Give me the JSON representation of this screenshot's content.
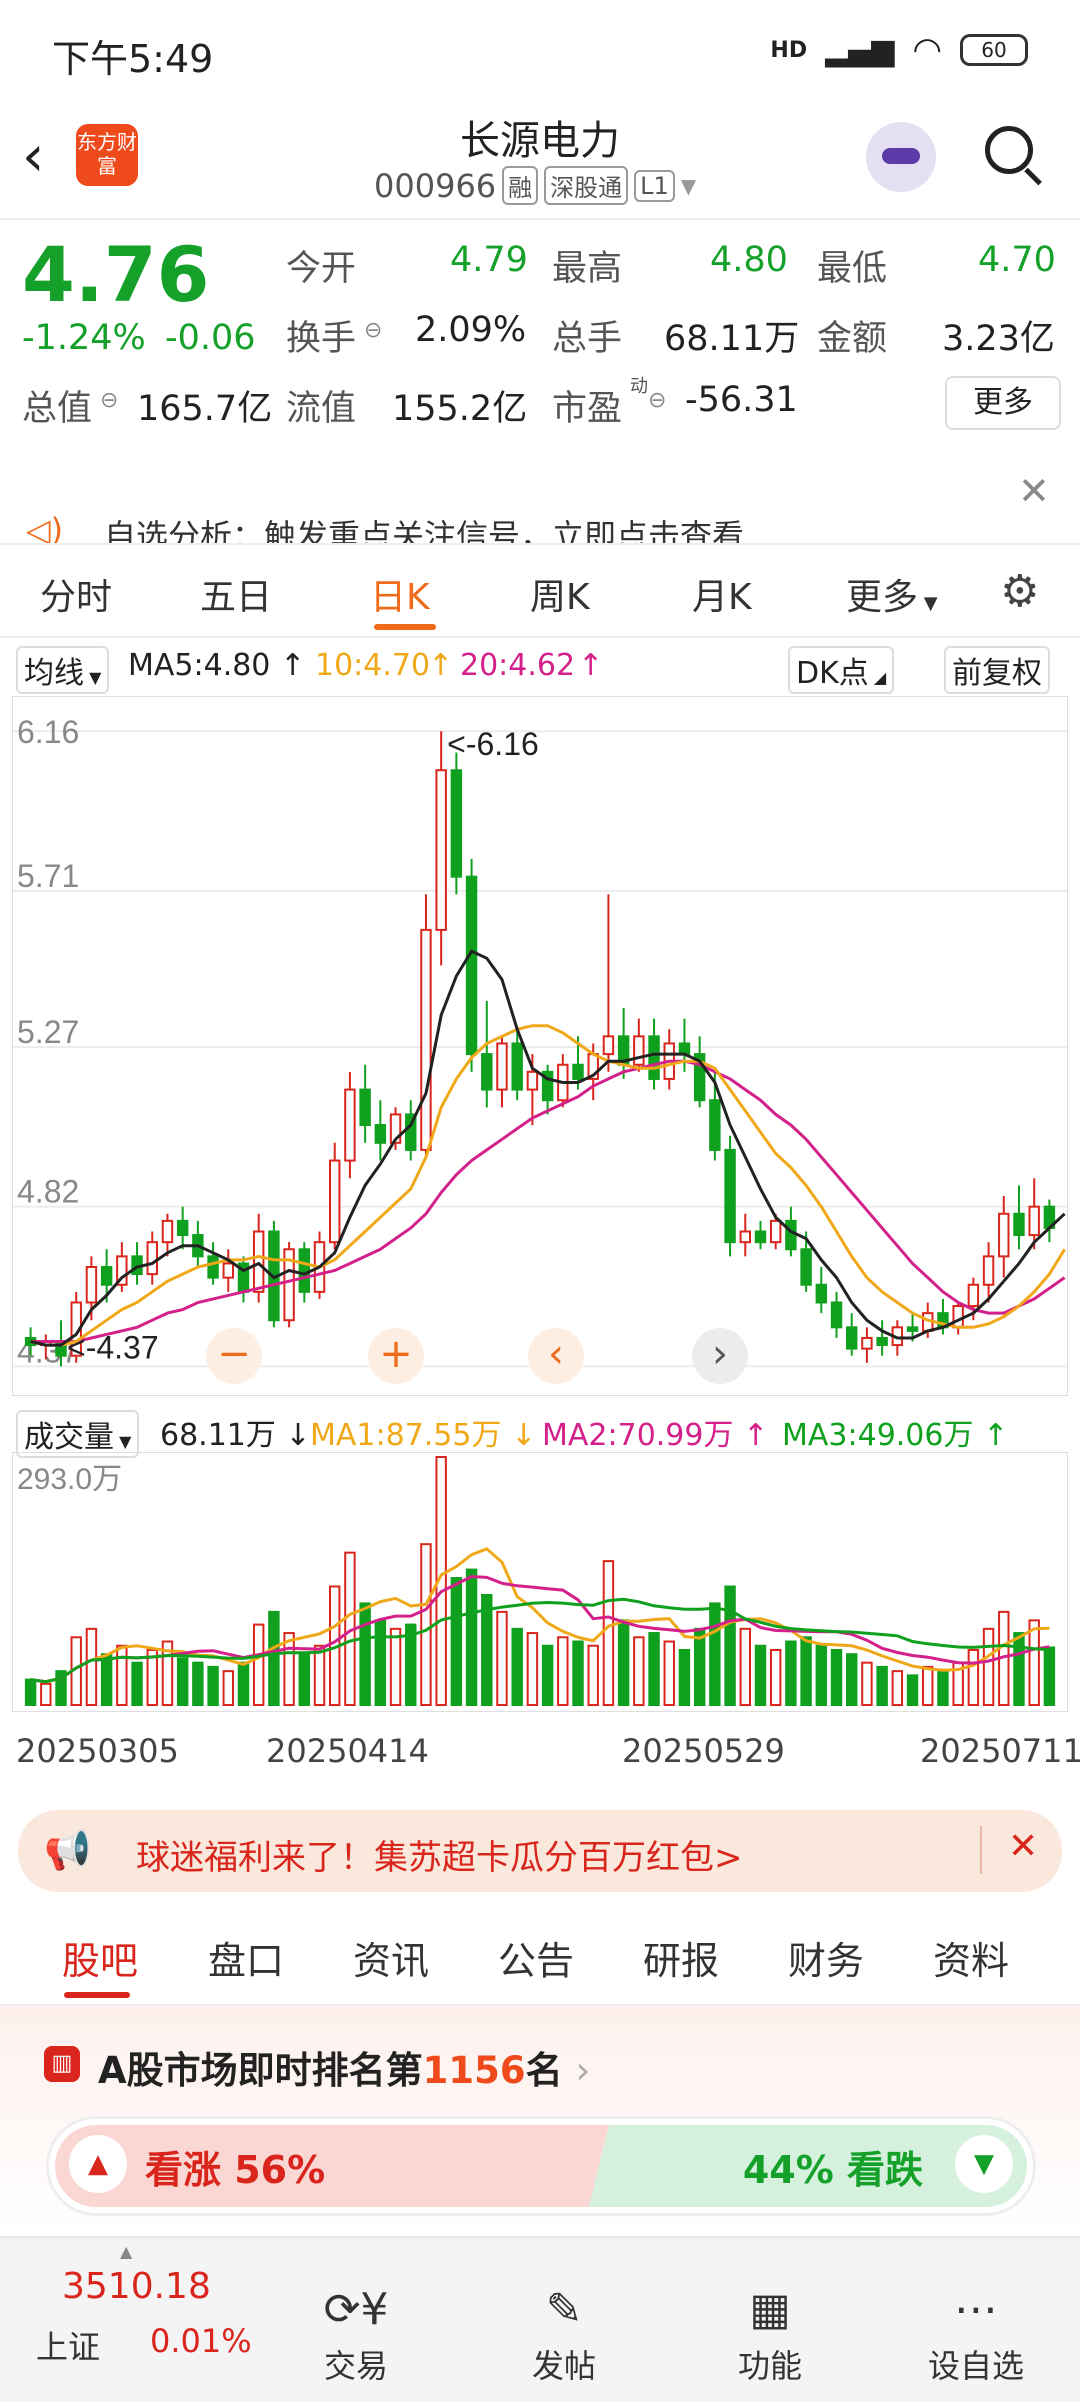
{
  "status": {
    "time": "下午5:49",
    "battery": "60",
    "signal": "HD"
  },
  "nav": {
    "title": "长源电力",
    "code": "000966",
    "tags": [
      "融",
      "深股通",
      "L1"
    ],
    "logo_text": "东方财富"
  },
  "quote": {
    "price": "4.76",
    "change_pct": "-1.24%",
    "change": "-0.06",
    "open_label": "今开",
    "open": "4.79",
    "high_label": "最高",
    "high": "4.80",
    "low_label": "最低",
    "low": "4.70",
    "turnover_label": "换手",
    "turnover": "2.09%",
    "volume_label": "总手",
    "volume": "68.11万",
    "amount_label": "金额",
    "amount": "3.23亿",
    "mktcap_label": "总值",
    "mktcap": "165.7亿",
    "float_label": "流值",
    "float": "155.2亿",
    "pe_label": "市盈",
    "pe_sup": "动",
    "pe": "-56.31",
    "more": "更多"
  },
  "notice": {
    "text": "自选分析：触发重点关注信号，立即点击查看"
  },
  "tabs": [
    "分时",
    "五日",
    "日K",
    "周K",
    "月K",
    "更多"
  ],
  "indicators": {
    "ma_select": "均线",
    "ma5": "MA5:4.80",
    "ma10": "10:4.70",
    "ma20": "20:4.62",
    "dk": "DK点",
    "adjust": "前复权",
    "colors": {
      "ma5": "#222222",
      "ma10": "#f0a818",
      "ma20": "#d4208a"
    }
  },
  "vol_indicators": {
    "select": "成交量",
    "vol": "68.11万",
    "ma1": "MA1:87.55万",
    "ma2": "MA2:70.99万",
    "ma3": "MA3:49.06万"
  },
  "chart_data": {
    "type": "candlestick",
    "y_ticks": [
      "6.16",
      "5.71",
      "5.27",
      "4.82",
      "4.37"
    ],
    "max_label": "<-6.16",
    "min_label": "4.37",
    "volume_max_label": "293.0万",
    "x_labels": [
      "20250305",
      "20250414",
      "20250529",
      "20250711"
    ],
    "up_color": "#d9251c",
    "down_color": "#0fa01e",
    "candles": [
      {
        "o": 4.45,
        "h": 4.48,
        "l": 4.4,
        "c": 4.43,
        "v": 30
      },
      {
        "o": 4.43,
        "h": 4.46,
        "l": 4.39,
        "c": 4.44,
        "v": 25
      },
      {
        "o": 4.44,
        "h": 4.5,
        "l": 4.37,
        "c": 4.4,
        "v": 40
      },
      {
        "o": 4.4,
        "h": 4.58,
        "l": 4.38,
        "c": 4.55,
        "v": 80
      },
      {
        "o": 4.55,
        "h": 4.68,
        "l": 4.5,
        "c": 4.65,
        "v": 90
      },
      {
        "o": 4.65,
        "h": 4.7,
        "l": 4.55,
        "c": 4.6,
        "v": 60
      },
      {
        "o": 4.6,
        "h": 4.72,
        "l": 4.58,
        "c": 4.68,
        "v": 70
      },
      {
        "o": 4.68,
        "h": 4.72,
        "l": 4.6,
        "c": 4.63,
        "v": 50
      },
      {
        "o": 4.63,
        "h": 4.75,
        "l": 4.6,
        "c": 4.72,
        "v": 65
      },
      {
        "o": 4.72,
        "h": 4.8,
        "l": 4.68,
        "c": 4.78,
        "v": 75
      },
      {
        "o": 4.78,
        "h": 4.82,
        "l": 4.7,
        "c": 4.74,
        "v": 55
      },
      {
        "o": 4.74,
        "h": 4.78,
        "l": 4.65,
        "c": 4.68,
        "v": 50
      },
      {
        "o": 4.68,
        "h": 4.72,
        "l": 4.6,
        "c": 4.62,
        "v": 45
      },
      {
        "o": 4.62,
        "h": 4.7,
        "l": 4.58,
        "c": 4.66,
        "v": 40
      },
      {
        "o": 4.66,
        "h": 4.68,
        "l": 4.55,
        "c": 4.58,
        "v": 50
      },
      {
        "o": 4.58,
        "h": 4.8,
        "l": 4.55,
        "c": 4.75,
        "v": 95
      },
      {
        "o": 4.75,
        "h": 4.78,
        "l": 4.48,
        "c": 4.5,
        "v": 110
      },
      {
        "o": 4.5,
        "h": 4.72,
        "l": 4.48,
        "c": 4.7,
        "v": 85
      },
      {
        "o": 4.7,
        "h": 4.72,
        "l": 4.55,
        "c": 4.58,
        "v": 60
      },
      {
        "o": 4.58,
        "h": 4.75,
        "l": 4.56,
        "c": 4.72,
        "v": 70
      },
      {
        "o": 4.72,
        "h": 5.0,
        "l": 4.7,
        "c": 4.95,
        "v": 140
      },
      {
        "o": 4.95,
        "h": 5.2,
        "l": 4.9,
        "c": 5.15,
        "v": 180
      },
      {
        "o": 5.15,
        "h": 5.22,
        "l": 5.0,
        "c": 5.05,
        "v": 120
      },
      {
        "o": 5.05,
        "h": 5.12,
        "l": 4.95,
        "c": 5.0,
        "v": 100
      },
      {
        "o": 5.0,
        "h": 5.1,
        "l": 4.98,
        "c": 5.08,
        "v": 90
      },
      {
        "o": 5.08,
        "h": 5.12,
        "l": 4.95,
        "c": 4.98,
        "v": 95
      },
      {
        "o": 4.98,
        "h": 5.7,
        "l": 4.96,
        "c": 5.6,
        "v": 190
      },
      {
        "o": 5.6,
        "h": 6.16,
        "l": 5.5,
        "c": 6.05,
        "v": 293
      },
      {
        "o": 6.05,
        "h": 6.1,
        "l": 5.7,
        "c": 5.75,
        "v": 150
      },
      {
        "o": 5.75,
        "h": 5.8,
        "l": 5.2,
        "c": 5.25,
        "v": 160
      },
      {
        "o": 5.25,
        "h": 5.4,
        "l": 5.1,
        "c": 5.15,
        "v": 130
      },
      {
        "o": 5.15,
        "h": 5.3,
        "l": 5.1,
        "c": 5.28,
        "v": 110
      },
      {
        "o": 5.28,
        "h": 5.32,
        "l": 5.12,
        "c": 5.15,
        "v": 90
      },
      {
        "o": 5.15,
        "h": 5.25,
        "l": 5.05,
        "c": 5.2,
        "v": 85
      },
      {
        "o": 5.2,
        "h": 5.22,
        "l": 5.08,
        "c": 5.12,
        "v": 70
      },
      {
        "o": 5.12,
        "h": 5.25,
        "l": 5.1,
        "c": 5.22,
        "v": 80
      },
      {
        "o": 5.22,
        "h": 5.3,
        "l": 5.15,
        "c": 5.18,
        "v": 75
      },
      {
        "o": 5.18,
        "h": 5.28,
        "l": 5.12,
        "c": 5.25,
        "v": 70
      },
      {
        "o": 5.25,
        "h": 5.7,
        "l": 5.2,
        "c": 5.3,
        "v": 170
      },
      {
        "o": 5.3,
        "h": 5.38,
        "l": 5.18,
        "c": 5.22,
        "v": 100
      },
      {
        "o": 5.22,
        "h": 5.35,
        "l": 5.2,
        "c": 5.3,
        "v": 80
      },
      {
        "o": 5.3,
        "h": 5.35,
        "l": 5.15,
        "c": 5.18,
        "v": 85
      },
      {
        "o": 5.18,
        "h": 5.32,
        "l": 5.15,
        "c": 5.28,
        "v": 75
      },
      {
        "o": 5.28,
        "h": 5.35,
        "l": 5.2,
        "c": 5.25,
        "v": 65
      },
      {
        "o": 5.25,
        "h": 5.3,
        "l": 5.1,
        "c": 5.12,
        "v": 90
      },
      {
        "o": 5.12,
        "h": 5.2,
        "l": 4.95,
        "c": 4.98,
        "v": 120
      },
      {
        "o": 4.98,
        "h": 5.02,
        "l": 4.68,
        "c": 4.72,
        "v": 140
      },
      {
        "o": 4.72,
        "h": 4.8,
        "l": 4.68,
        "c": 4.75,
        "v": 90
      },
      {
        "o": 4.75,
        "h": 4.78,
        "l": 4.7,
        "c": 4.72,
        "v": 70
      },
      {
        "o": 4.72,
        "h": 4.8,
        "l": 4.7,
        "c": 4.78,
        "v": 65
      },
      {
        "o": 4.78,
        "h": 4.82,
        "l": 4.68,
        "c": 4.7,
        "v": 75
      },
      {
        "o": 4.7,
        "h": 4.75,
        "l": 4.58,
        "c": 4.6,
        "v": 80
      },
      {
        "o": 4.6,
        "h": 4.65,
        "l": 4.52,
        "c": 4.55,
        "v": 70
      },
      {
        "o": 4.55,
        "h": 4.58,
        "l": 4.45,
        "c": 4.48,
        "v": 65
      },
      {
        "o": 4.48,
        "h": 4.52,
        "l": 4.4,
        "c": 4.42,
        "v": 60
      },
      {
        "o": 4.42,
        "h": 4.48,
        "l": 4.38,
        "c": 4.45,
        "v": 50
      },
      {
        "o": 4.45,
        "h": 4.5,
        "l": 4.4,
        "c": 4.43,
        "v": 45
      },
      {
        "o": 4.43,
        "h": 4.5,
        "l": 4.4,
        "c": 4.48,
        "v": 40
      },
      {
        "o": 4.48,
        "h": 4.52,
        "l": 4.44,
        "c": 4.47,
        "v": 35
      },
      {
        "o": 4.47,
        "h": 4.55,
        "l": 4.45,
        "c": 4.52,
        "v": 45
      },
      {
        "o": 4.52,
        "h": 4.56,
        "l": 4.46,
        "c": 4.48,
        "v": 40
      },
      {
        "o": 4.48,
        "h": 4.55,
        "l": 4.46,
        "c": 4.54,
        "v": 50
      },
      {
        "o": 4.54,
        "h": 4.62,
        "l": 4.5,
        "c": 4.6,
        "v": 65
      },
      {
        "o": 4.6,
        "h": 4.72,
        "l": 4.55,
        "c": 4.68,
        "v": 90
      },
      {
        "o": 4.68,
        "h": 4.85,
        "l": 4.62,
        "c": 4.8,
        "v": 110
      },
      {
        "o": 4.8,
        "h": 4.88,
        "l": 4.7,
        "c": 4.74,
        "v": 85
      },
      {
        "o": 4.74,
        "h": 4.9,
        "l": 4.7,
        "c": 4.82,
        "v": 100
      },
      {
        "o": 4.82,
        "h": 4.84,
        "l": 4.72,
        "c": 4.76,
        "v": 68
      }
    ],
    "ma5": [
      4.44,
      4.43,
      4.43,
      4.46,
      4.53,
      4.57,
      4.62,
      4.65,
      4.66,
      4.69,
      4.71,
      4.71,
      4.69,
      4.67,
      4.64,
      4.66,
      4.62,
      4.64,
      4.63,
      4.65,
      4.69,
      4.79,
      4.88,
      4.94,
      5.01,
      5.05,
      5.14,
      5.36,
      5.47,
      5.54,
      5.52,
      5.46,
      5.32,
      5.21,
      5.18,
      5.17,
      5.17,
      5.19,
      5.23,
      5.23,
      5.24,
      5.25,
      5.25,
      5.25,
      5.23,
      5.17,
      5.05,
      4.96,
      4.87,
      4.79,
      4.75,
      4.73,
      4.67,
      4.62,
      4.55,
      4.5,
      4.47,
      4.45,
      4.45,
      4.47,
      4.48,
      4.5,
      4.52,
      4.56,
      4.61,
      4.66,
      4.72,
      4.76,
      4.8
    ],
    "ma10": [
      4.44,
      4.43,
      4.43,
      4.44,
      4.47,
      4.5,
      4.53,
      4.55,
      4.58,
      4.61,
      4.63,
      4.65,
      4.66,
      4.67,
      4.67,
      4.68,
      4.67,
      4.67,
      4.66,
      4.65,
      4.67,
      4.71,
      4.75,
      4.79,
      4.83,
      4.87,
      4.96,
      5.1,
      5.18,
      5.24,
      5.28,
      5.3,
      5.32,
      5.33,
      5.33,
      5.31,
      5.28,
      5.25,
      5.23,
      5.22,
      5.21,
      5.21,
      5.22,
      5.23,
      5.23,
      5.21,
      5.15,
      5.09,
      5.03,
      4.97,
      4.93,
      4.88,
      4.82,
      4.75,
      4.68,
      4.62,
      4.58,
      4.55,
      4.52,
      4.5,
      4.49,
      4.48,
      4.48,
      4.49,
      4.51,
      4.54,
      4.58,
      4.63,
      4.7
    ],
    "ma20": [
      4.44,
      4.44,
      4.44,
      4.44,
      4.45,
      4.46,
      4.47,
      4.48,
      4.5,
      4.52,
      4.53,
      4.55,
      4.56,
      4.57,
      4.58,
      4.59,
      4.6,
      4.61,
      4.62,
      4.63,
      4.64,
      4.66,
      4.68,
      4.7,
      4.73,
      4.76,
      4.8,
      4.86,
      4.91,
      4.95,
      4.98,
      5.01,
      5.04,
      5.07,
      5.09,
      5.11,
      5.13,
      5.16,
      5.18,
      5.2,
      5.21,
      5.22,
      5.23,
      5.23,
      5.22,
      5.2,
      5.18,
      5.15,
      5.12,
      5.08,
      5.05,
      5.01,
      4.96,
      4.91,
      4.86,
      4.81,
      4.76,
      4.71,
      4.66,
      4.62,
      4.58,
      4.55,
      4.53,
      4.52,
      4.52,
      4.54,
      4.56,
      4.59,
      4.62
    ]
  },
  "banner": {
    "text": "球迷福利来了！集苏超卡瓜分百万红包>"
  },
  "tabs2": [
    "股吧",
    "盘口",
    "资讯",
    "公告",
    "研报",
    "财务",
    "资料"
  ],
  "rank": {
    "prefix": "A股市场即时排名第",
    "num": "1156",
    "suffix": "名"
  },
  "vote": {
    "up": "看涨 56%",
    "down": "44% 看跌",
    "up_pct": 0.56
  },
  "bottom": {
    "index_value": "3510.18",
    "index_name": "上证",
    "index_change": "0.01%",
    "items": [
      "交易",
      "发帖",
      "功能",
      "设自选"
    ]
  }
}
